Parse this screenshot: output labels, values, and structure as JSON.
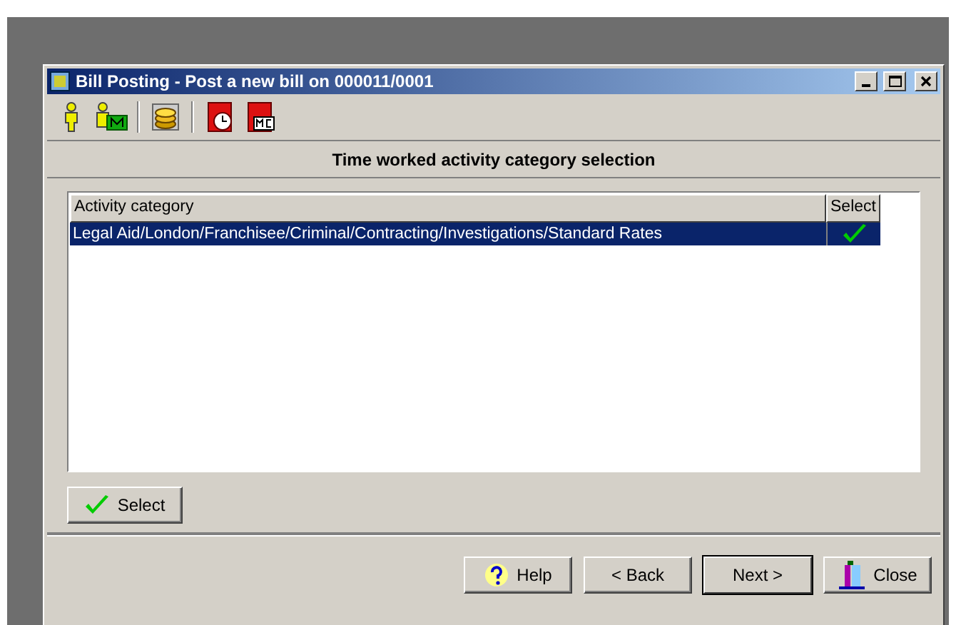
{
  "window": {
    "title": "Bill Posting - Post a new bill on 000011/0001"
  },
  "toolbar": {
    "groups": [
      [
        {
          "kind": "person"
        },
        {
          "kind": "person-m"
        }
      ],
      [
        {
          "kind": "coins"
        }
      ],
      [
        {
          "kind": "clock-doc"
        },
        {
          "kind": "mc-doc"
        }
      ]
    ]
  },
  "heading": "Time worked activity category selection",
  "table": {
    "columns": [
      "Activity category",
      "Select"
    ],
    "rows": [
      {
        "category": "Legal Aid/London/Franchisee/Criminal/Contracting/Investigations/Standard Rates",
        "checked": true,
        "selected": true
      }
    ]
  },
  "select_button": "Select",
  "buttons": [
    {
      "kind": "help",
      "label": "Help",
      "default": false
    },
    {
      "kind": "back",
      "label": "< Back",
      "default": false
    },
    {
      "kind": "next",
      "label": "Next >",
      "default": true
    },
    {
      "kind": "close",
      "label": "Close",
      "default": false
    }
  ]
}
